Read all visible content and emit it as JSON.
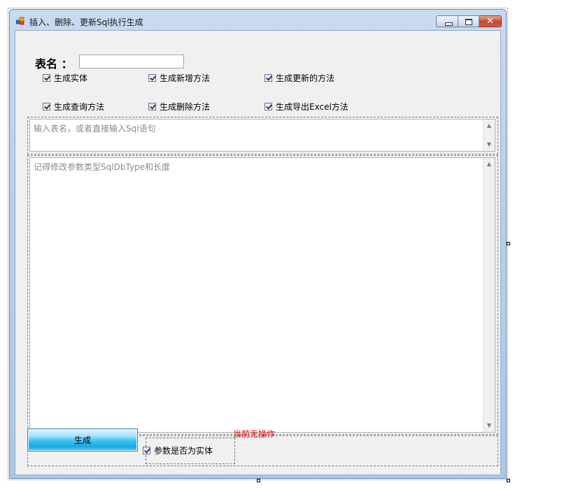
{
  "window": {
    "title": "插入、删除、更新Sql执行生成"
  },
  "form": {
    "table_label": "表名 ：",
    "table_value": "",
    "options": [
      {
        "label": "生成实体",
        "checked": true
      },
      {
        "label": "生成新增方法",
        "checked": true
      },
      {
        "label": "生成更新的方法",
        "checked": true
      },
      {
        "label": "生成查询方法",
        "checked": true
      },
      {
        "label": "生成删除方法",
        "checked": true
      },
      {
        "label": "生成导出Excel方法",
        "checked": true
      }
    ],
    "sql_input_placeholder": "输入表名，或者直接输入Sql语句",
    "output_placeholder": "记得修改参数类型SqlDbType和长度",
    "generate_label": "生成",
    "param_entity_label": "参数是否为实体",
    "param_entity_checked": true,
    "status": "当前无操作"
  },
  "colors": {
    "status": "#ff0000",
    "button_accent": "#37c2f3"
  }
}
